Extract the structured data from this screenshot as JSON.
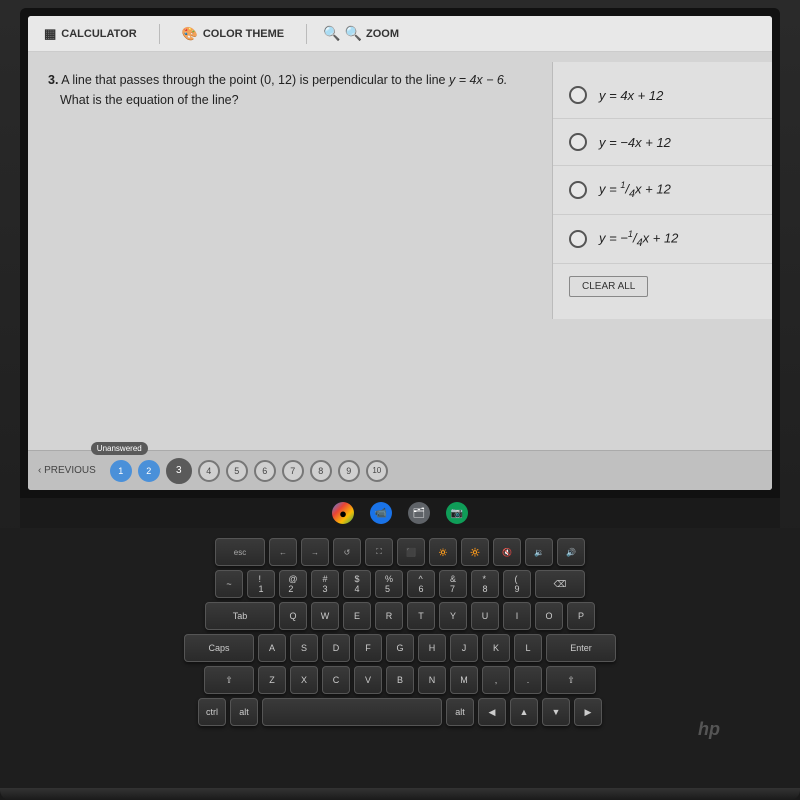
{
  "toolbar": {
    "calculator_label": "CALCULATOR",
    "color_theme_label": "COLOR THEME",
    "zoom_label": "ZOOM"
  },
  "question": {
    "number": "3.",
    "text": "A line that passes through the point (0, 12) is perpendicular to the line",
    "equation": "y = 4x − 6.",
    "subtext": "What is the equation of the line?"
  },
  "choices": [
    {
      "id": "A",
      "text": "y = 4x + 12"
    },
    {
      "id": "B",
      "text": "y = −4x + 12"
    },
    {
      "id": "C",
      "text": "y = ¼x + 12"
    },
    {
      "id": "D",
      "text": "y = −¼x + 12"
    }
  ],
  "clear_all_label": "CLEAR ALL",
  "nav": {
    "previous_label": "‹ PREVIOUS",
    "unanswered_label": "Unanswered",
    "dots": [
      {
        "num": "1",
        "state": "answered"
      },
      {
        "num": "2",
        "state": "answered"
      },
      {
        "num": "3",
        "state": "current"
      },
      {
        "num": "4",
        "state": "normal"
      },
      {
        "num": "5",
        "state": "normal"
      },
      {
        "num": "6",
        "state": "normal"
      },
      {
        "num": "7",
        "state": "normal"
      },
      {
        "num": "8",
        "state": "normal"
      },
      {
        "num": "9",
        "state": "normal"
      },
      {
        "num": "10",
        "state": "normal"
      }
    ]
  }
}
